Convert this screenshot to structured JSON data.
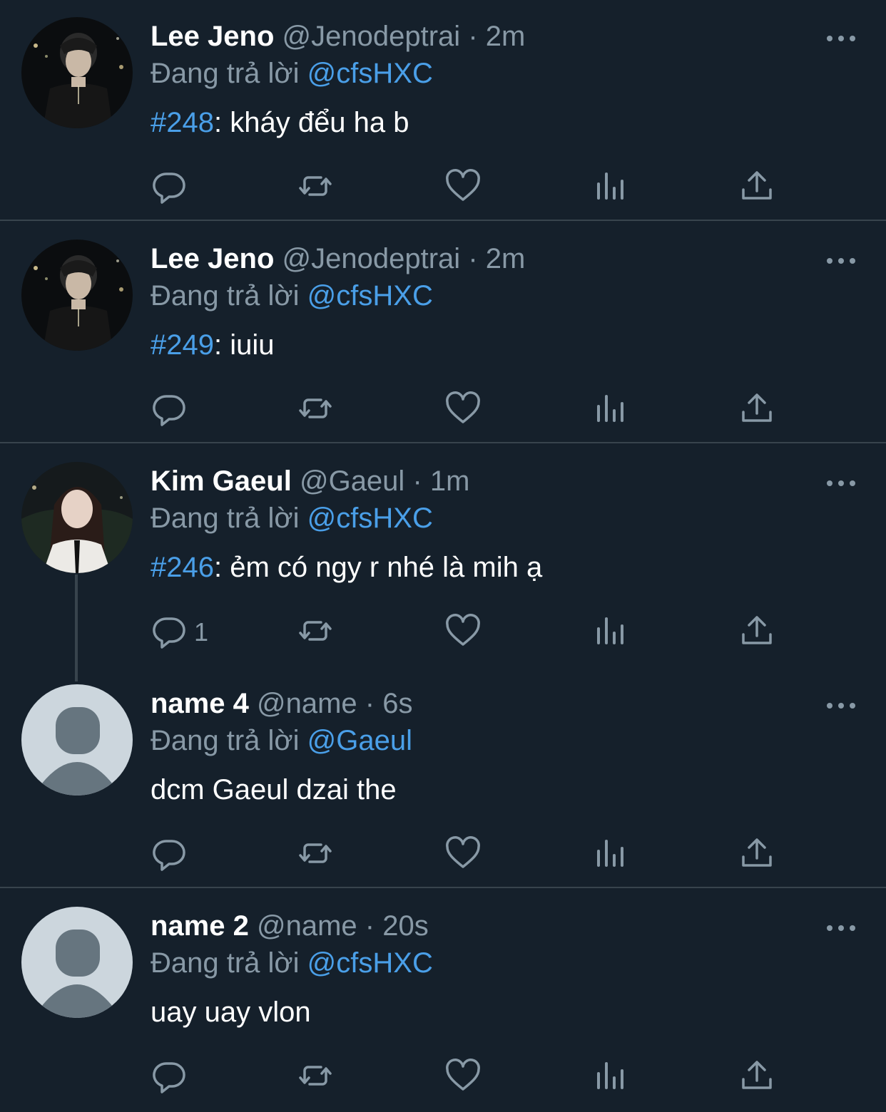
{
  "colors": {
    "background": "#15202b",
    "divider": "#38444d",
    "secondary_text": "#8899a6",
    "link": "#4a9fe8",
    "icon": "#8899a6"
  },
  "replying_prefix": "Đang trả lời",
  "tweets": [
    {
      "name": "Lee Jeno",
      "handle": "@Jenodeptrai",
      "time": "· 2m",
      "reply_to": "@cfsHXC",
      "tag": "#248",
      "text": ": kháy đểu ha b",
      "reply_count": "",
      "avatar": "photo-avatar-jeno"
    },
    {
      "name": "Lee Jeno",
      "handle": "@Jenodeptrai",
      "time": "· 2m",
      "reply_to": "@cfsHXC",
      "tag": "#249",
      "text": ": iuiu",
      "reply_count": "",
      "avatar": "photo-avatar-jeno"
    },
    {
      "name": "Kim Gaeul",
      "handle": "@Gaeul",
      "time": "· 1m",
      "reply_to": "@cfsHXC",
      "tag": "#246",
      "text": ": ẻm có ngy r nhé là mih ạ",
      "reply_count": "1",
      "avatar": "photo-avatar-gaeul"
    },
    {
      "name": "name 4",
      "handle": "@name",
      "time": "· 6s",
      "reply_to": "@Gaeul",
      "tag": "",
      "text": "dcm Gaeul dzai the",
      "reply_count": "",
      "avatar": "default-avatar"
    },
    {
      "name": "name 2",
      "handle": "@name",
      "time": "· 20s",
      "reply_to": "@cfsHXC",
      "tag": "",
      "text": "uay uay vlon",
      "reply_count": "",
      "avatar": "default-avatar"
    }
  ]
}
